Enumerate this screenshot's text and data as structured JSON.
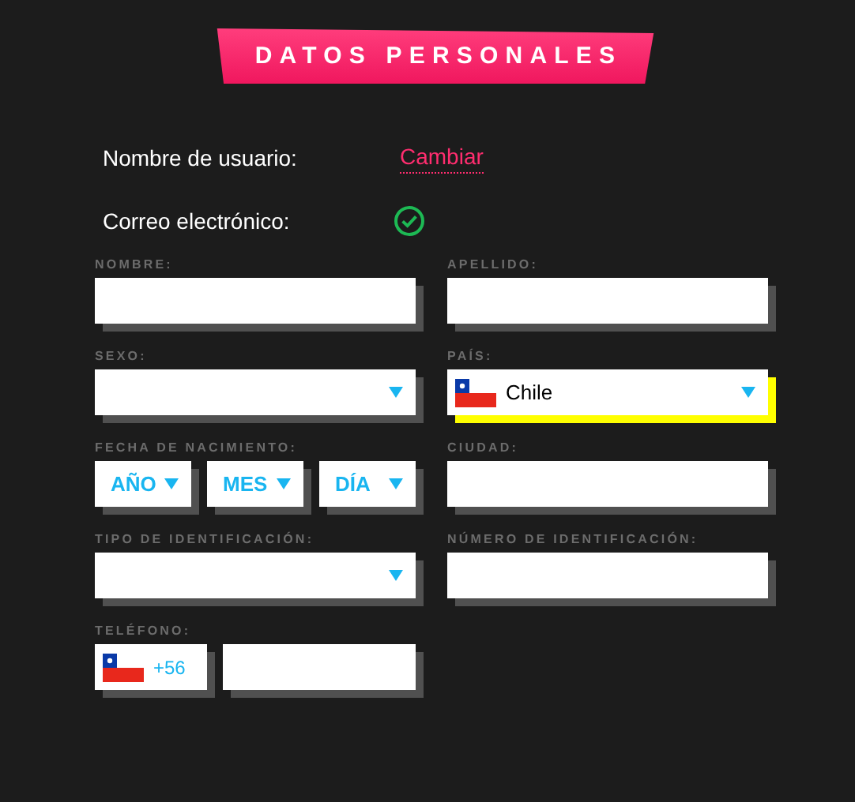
{
  "title": "DATOS PERSONALES",
  "account": [
    {
      "kind": "link",
      "label": "Nombre de usuario:",
      "value": "Cambiar"
    },
    {
      "kind": "verified",
      "label": "Correo electrónico:"
    }
  ],
  "fields": [
    {
      "kind": "text",
      "label": "NOMBRE:"
    },
    {
      "kind": "text",
      "label": "APELLIDO:"
    },
    {
      "kind": "select",
      "label": "SEXO:",
      "focused": false
    },
    {
      "kind": "select",
      "label": "PAÍS:",
      "value": "Chile",
      "flag": true,
      "focused": true
    },
    {
      "kind": "date",
      "label": "FECHA DE NACIMIENTO:",
      "parts": [
        "AÑO",
        "MES",
        "DÍA"
      ]
    },
    {
      "kind": "text",
      "label": "CIUDAD:"
    },
    {
      "kind": "select",
      "label": "TIPO DE IDENTIFICACIÓN:",
      "focused": false
    },
    {
      "kind": "text",
      "label": "NÚMERO DE IDENTIFICACIÓN:"
    },
    {
      "kind": "phone",
      "label": "TELÉFONO:",
      "code": "+56"
    }
  ]
}
